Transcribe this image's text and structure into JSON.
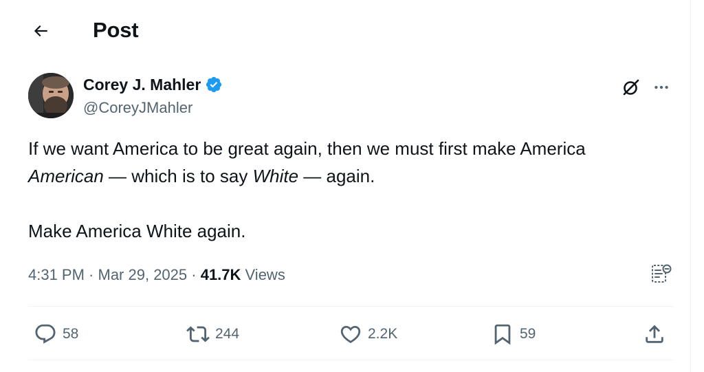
{
  "header": {
    "title": "Post",
    "back_icon": "back-arrow-icon"
  },
  "author": {
    "name": "Corey J. Mahler",
    "handle": "@CoreyJMahler",
    "verified": true,
    "verified_color": "#1d9bf0"
  },
  "tweet": {
    "line1_a": "If we want America to be great again, then we must first make America",
    "line2_em1": "American",
    "line2_mid": " — which is to say ",
    "line2_em2": "White",
    "line2_end": " — again.",
    "line3": "Make America White again."
  },
  "meta": {
    "time": "4:31 PM",
    "sep1": " · ",
    "date": "Mar 29, 2025",
    "sep2": " · ",
    "views_count": "41.7K",
    "views_label": " Views"
  },
  "actions": {
    "replies": "58",
    "reposts": "244",
    "likes": "2.2K",
    "bookmarks": "59"
  },
  "colors": {
    "text": "#0f1419",
    "secondary": "#536471",
    "accent": "#1d9bf0",
    "divider": "#eff3f4"
  }
}
